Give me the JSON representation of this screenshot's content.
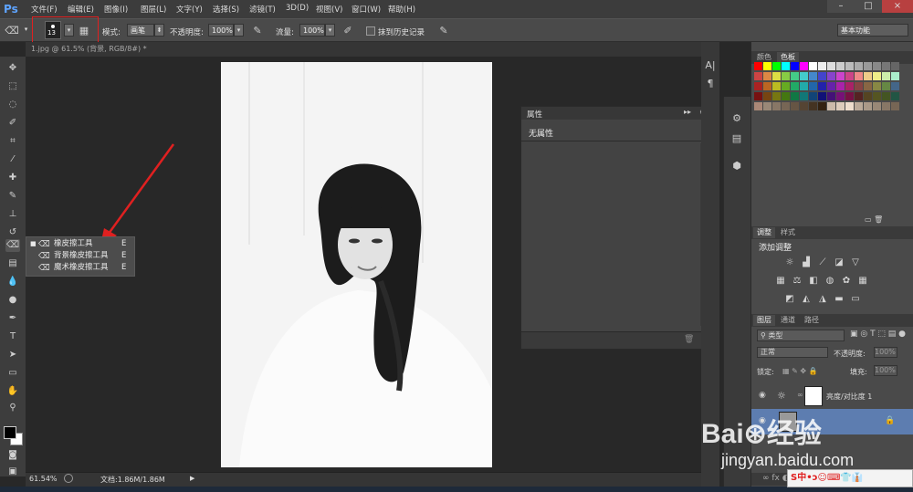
{
  "app": {
    "logo": "Ps"
  },
  "menu": [
    "文件(F)",
    "编辑(E)",
    "图像(I)",
    "图层(L)",
    "文字(Y)",
    "选择(S)",
    "滤镜(T)",
    "3D(D)",
    "视图(V)",
    "窗口(W)",
    "帮助(H)"
  ],
  "window_controls": {
    "minimize": "–",
    "maximize": "□",
    "close": "×"
  },
  "options": {
    "brush_size": "13",
    "mode_label": "模式:",
    "mode_value": "画笔",
    "opacity_label": "不透明度:",
    "opacity_value": "100%",
    "flow_label": "流量:",
    "flow_value": "100%",
    "history_label": "抹到历史记录",
    "workspace": "基本功能"
  },
  "document_tab": "1.jpg @ 61.5% (背景, RGB/8#) *",
  "flyout": [
    {
      "label": "橡皮擦工具",
      "key": "E",
      "active": true
    },
    {
      "label": "背景橡皮擦工具",
      "key": "E",
      "active": false
    },
    {
      "label": "魔术橡皮擦工具",
      "key": "E",
      "active": false
    }
  ],
  "status": {
    "zoom": "61.54%",
    "doc": "文档:1.86M/1.86M"
  },
  "properties": {
    "title": "属性",
    "empty_text": "无属性"
  },
  "panels": {
    "color_tabs": [
      "颜色",
      "色板"
    ],
    "adjust_tabs": [
      "调整",
      "样式"
    ],
    "adjust_title": "添加调整",
    "layers_tabs": [
      "图层",
      "通道",
      "路径"
    ],
    "kind_label": "类型",
    "blend_mode": "正常",
    "opacity_label": "不透明度:",
    "opacity_value": "100%",
    "lock_label": "锁定:",
    "fill_label": "填充:",
    "fill_value": "100%",
    "layer1_name": "亮度/对比度 1"
  },
  "watermark": {
    "brand": "Bai⊛经验",
    "url": "jingyan.baidu.com"
  },
  "ime": "S中•ɔ☺⌨👕👔"
}
